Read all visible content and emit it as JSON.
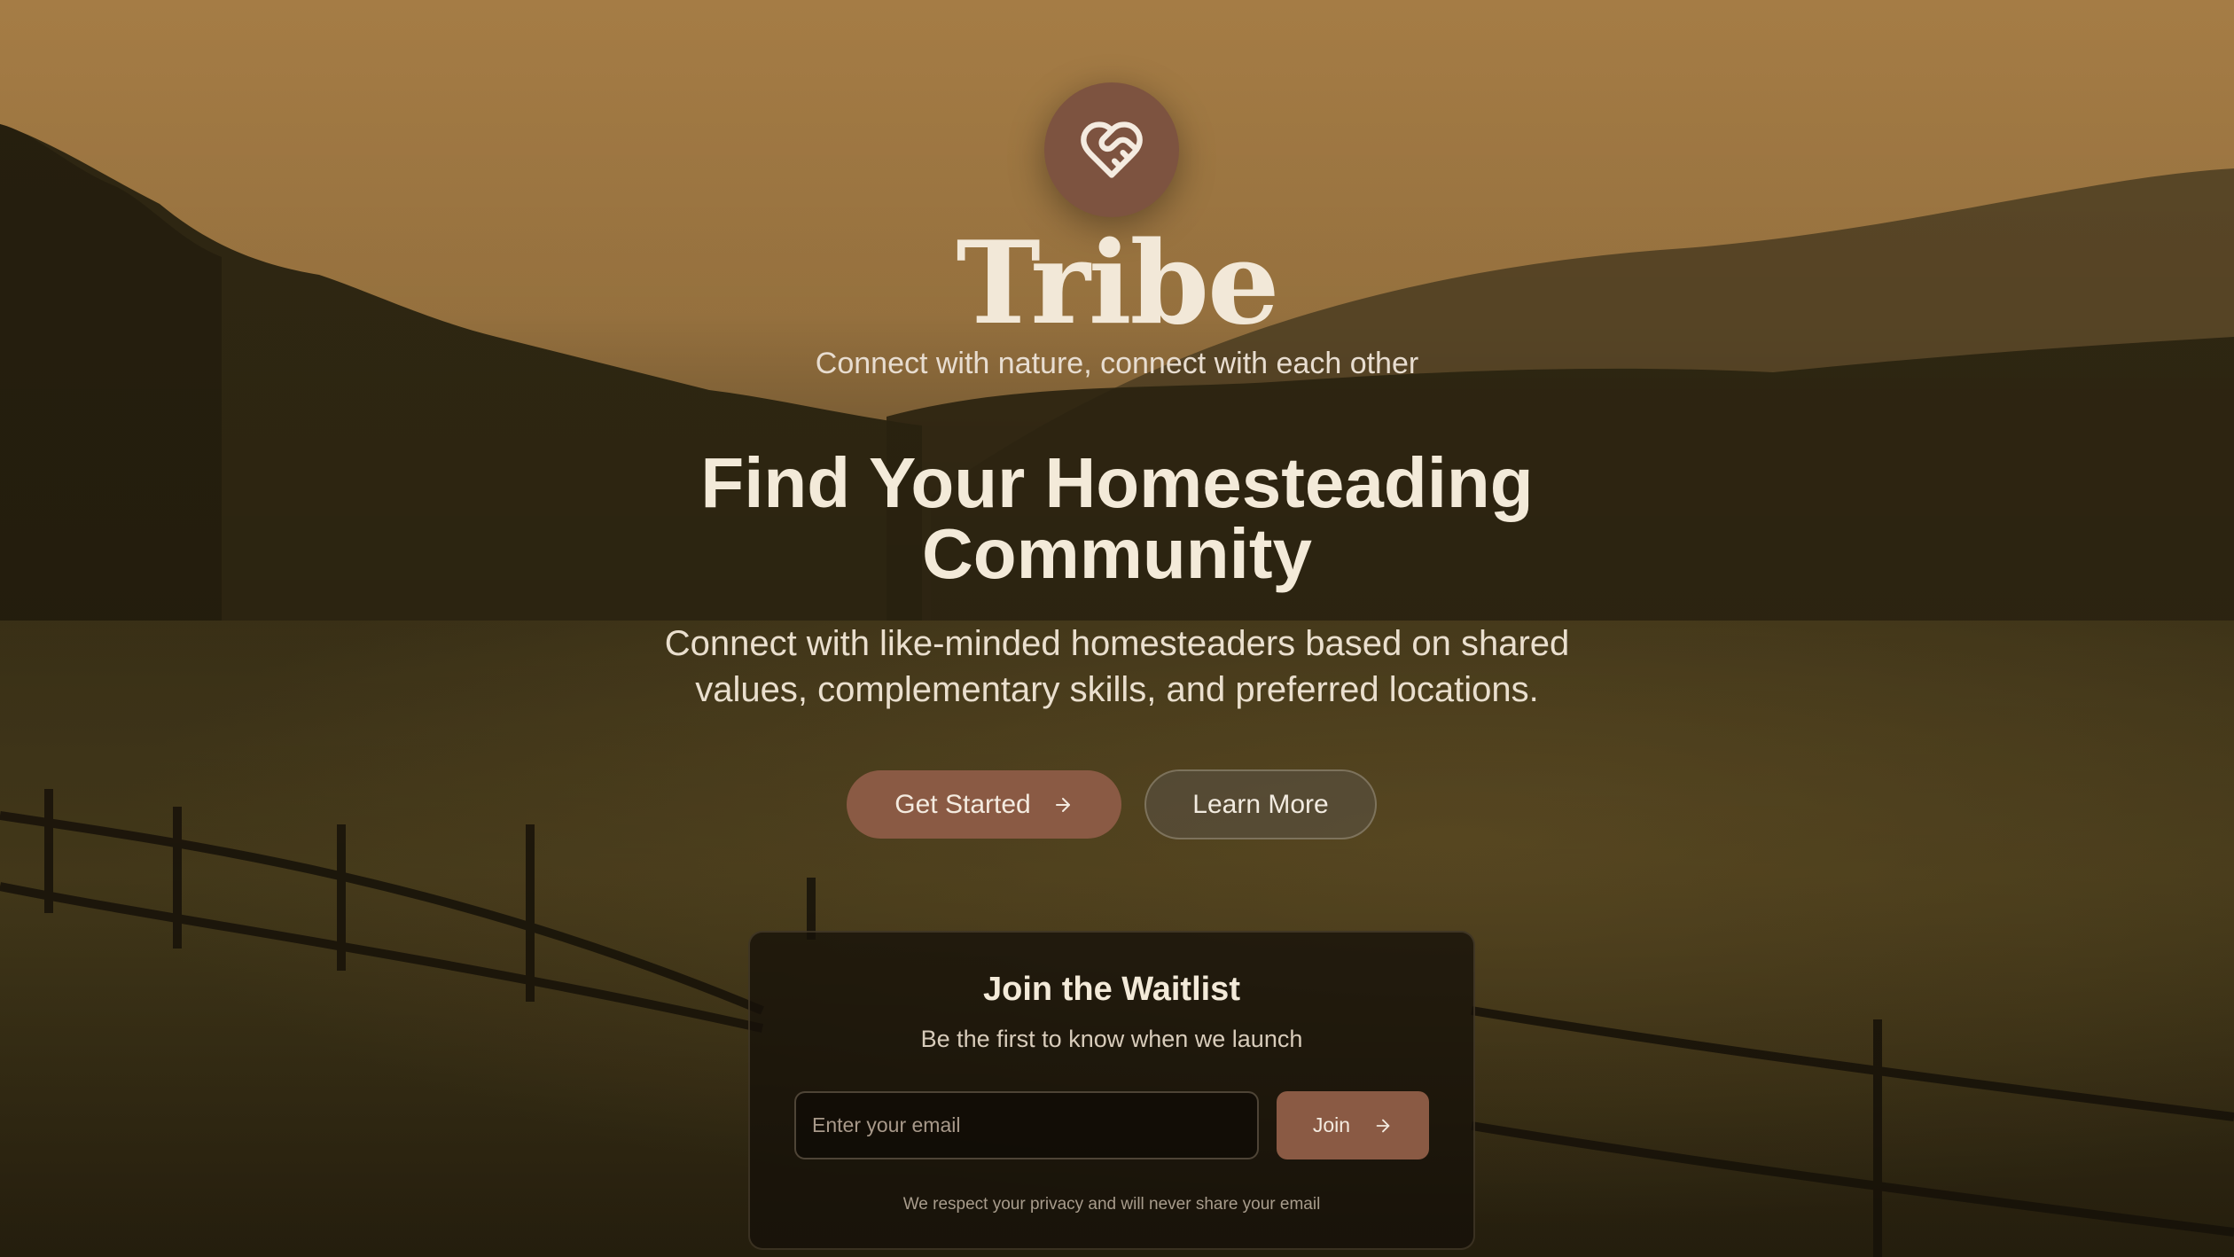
{
  "brand": {
    "name": "Tribe",
    "tagline": "Connect with nature, connect with each other",
    "logo_icon": "heart-handshake-icon"
  },
  "hero": {
    "headline_line1": "Find Your Homesteading",
    "headline_line2": "Community",
    "subheadline_line1": "Connect with like-minded homesteaders based on shared",
    "subheadline_line2": "values, complementary skills, and preferred locations.",
    "primary_button": "Get Started",
    "secondary_button": "Learn More"
  },
  "waitlist": {
    "title": "Join the Waitlist",
    "subtitle": "Be the first to know when we launch",
    "email_placeholder": "Enter your email",
    "email_value": "",
    "join_button": "Join",
    "privacy_note": "We respect your privacy and will never share your email"
  },
  "colors": {
    "accent": "#8a5a44",
    "logo_bg": "#7d5340",
    "text_light": "#f3ead9",
    "sky": "#a97f45"
  }
}
